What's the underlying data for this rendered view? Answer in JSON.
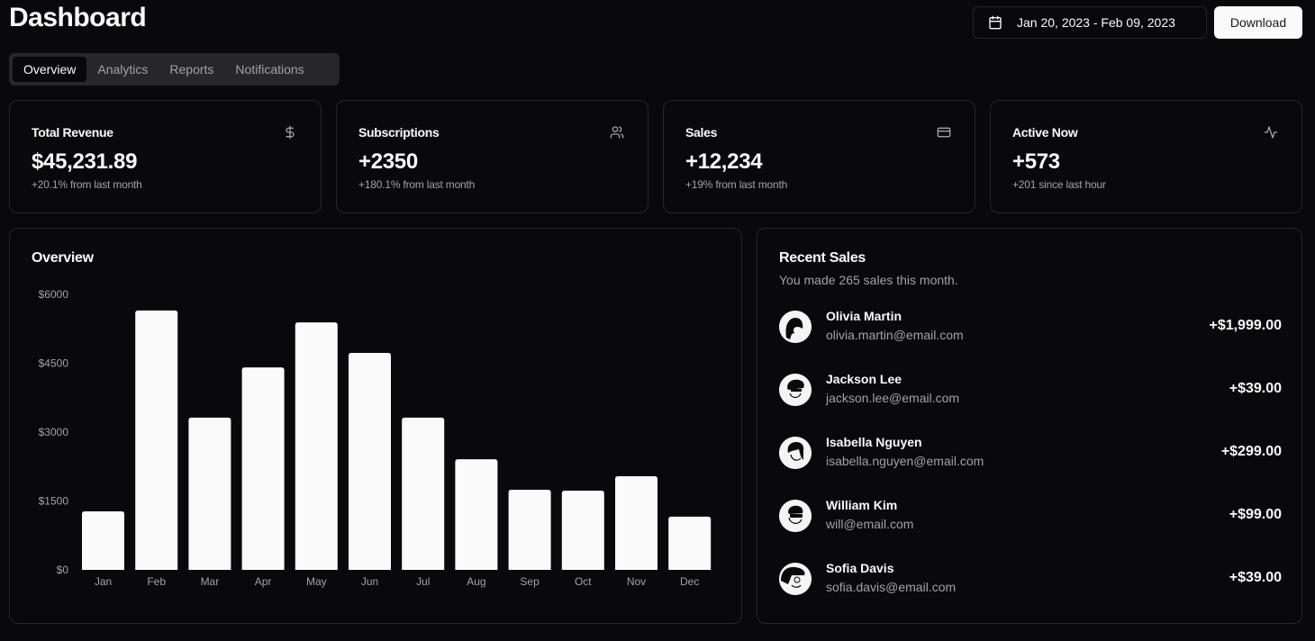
{
  "header": {
    "title": "Dashboard",
    "date_range": "Jan 20, 2023 - Feb 09, 2023",
    "download_label": "Download"
  },
  "tabs": [
    {
      "label": "Overview",
      "active": true
    },
    {
      "label": "Analytics",
      "active": false
    },
    {
      "label": "Reports",
      "active": false
    },
    {
      "label": "Notifications",
      "active": false
    }
  ],
  "stats": [
    {
      "label": "Total Revenue",
      "value": "$45,231.89",
      "sub": "+20.1% from last month",
      "icon": "dollar-icon"
    },
    {
      "label": "Subscriptions",
      "value": "+2350",
      "sub": "+180.1% from last month",
      "icon": "users-icon"
    },
    {
      "label": "Sales",
      "value": "+12,234",
      "sub": "+19% from last month",
      "icon": "credit-card-icon"
    },
    {
      "label": "Active Now",
      "value": "+573",
      "sub": "+201 since last hour",
      "icon": "activity-icon"
    }
  ],
  "overview": {
    "title": "Overview"
  },
  "chart_data": {
    "type": "bar",
    "title": "Overview",
    "categories": [
      "Jan",
      "Feb",
      "Mar",
      "Apr",
      "May",
      "Jun",
      "Jul",
      "Aug",
      "Sep",
      "Oct",
      "Nov",
      "Dec"
    ],
    "values": [
      1275,
      5650,
      3315,
      4410,
      5390,
      4725,
      3315,
      2410,
      1745,
      1725,
      2040,
      1160
    ],
    "yticks": [
      0,
      1500,
      3000,
      4500,
      6000
    ],
    "ytick_labels": [
      "$0",
      "$1500",
      "$3000",
      "$4500",
      "$6000"
    ],
    "ylim": [
      0,
      6000
    ],
    "xlabel": "",
    "ylabel": "",
    "grid": false,
    "bar_color": "#fafafa"
  },
  "recent_sales": {
    "title": "Recent Sales",
    "description": "You made 265 sales this month.",
    "items": [
      {
        "name": "Olivia Martin",
        "email": "olivia.martin@email.com",
        "amount": "+$1,999.00"
      },
      {
        "name": "Jackson Lee",
        "email": "jackson.lee@email.com",
        "amount": "+$39.00"
      },
      {
        "name": "Isabella Nguyen",
        "email": "isabella.nguyen@email.com",
        "amount": "+$299.00"
      },
      {
        "name": "William Kim",
        "email": "will@email.com",
        "amount": "+$99.00"
      },
      {
        "name": "Sofia Davis",
        "email": "sofia.davis@email.com",
        "amount": "+$39.00"
      }
    ]
  },
  "colors": {
    "background": "#09090b",
    "border": "#27272a",
    "muted_text": "#a1a1aa",
    "foreground": "#fafafa"
  }
}
